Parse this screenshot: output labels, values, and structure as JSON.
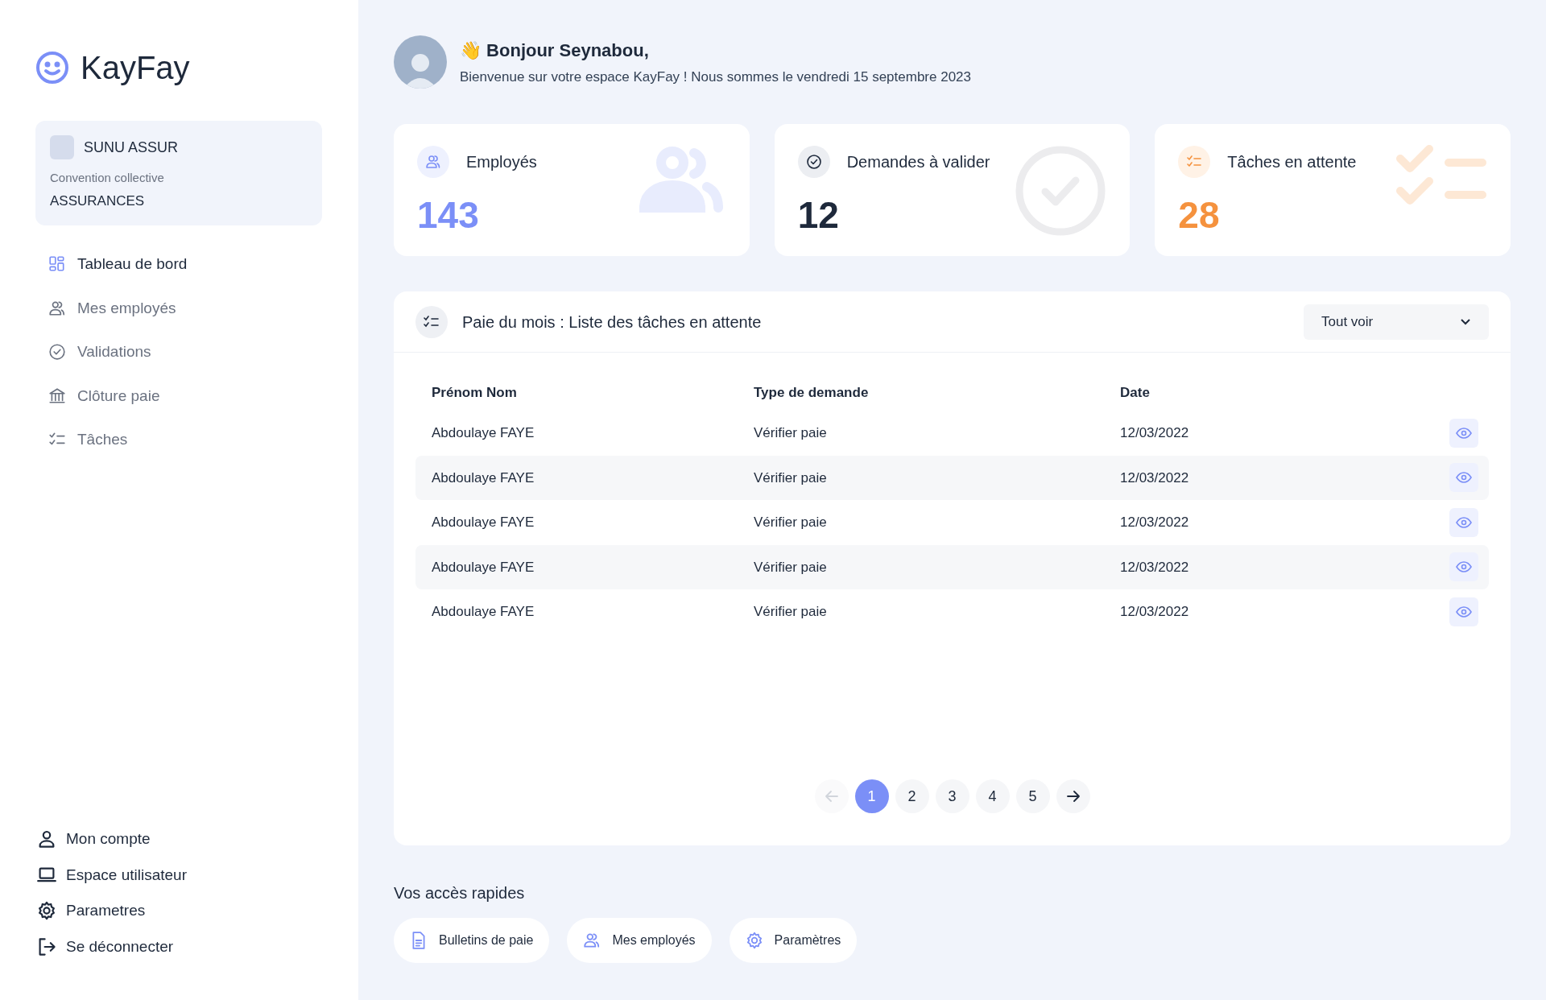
{
  "sidebar": {
    "brand": "KayFay",
    "company": {
      "name": "SUNU ASSUR",
      "label": "Convention collective",
      "value": "ASSURANCES"
    },
    "items": [
      {
        "label": "Tableau de bord",
        "kind": "dashboard",
        "selected": true
      },
      {
        "label": "Mes employés",
        "kind": "users",
        "selected": false
      },
      {
        "label": "Validations",
        "kind": "check",
        "selected": false
      },
      {
        "label": "Clôture paie",
        "kind": "bank",
        "selected": false
      },
      {
        "label": "Tâches",
        "kind": "tasks",
        "selected": false
      }
    ],
    "footer_items": [
      {
        "label": "Mon compte",
        "kind": "user"
      },
      {
        "label": "Espace utilisateur",
        "kind": "laptop"
      },
      {
        "label": "Parametres",
        "kind": "gear"
      },
      {
        "label": "Se déconnecter",
        "kind": "logout"
      }
    ]
  },
  "header": {
    "emoji": "👋",
    "greeting": "Bonjour Seynabou,",
    "subtitle": "Bienvenue sur votre espace KayFay ! Nous sommes le vendredi 15 septembre 2023"
  },
  "cards": [
    {
      "kind": "employees",
      "title": "Employés",
      "value": "143"
    },
    {
      "kind": "requests",
      "title": "Demandes à valider",
      "value": "12"
    },
    {
      "kind": "tasks",
      "title": "Tâches en attente",
      "value": "28"
    }
  ],
  "tasks_panel": {
    "title": "Paie du mois : Liste des tâches en attente",
    "filter": "Tout voir",
    "columns": [
      "Prénom Nom",
      "Type de demande",
      "Date"
    ],
    "rows": [
      {
        "name": "Abdoulaye FAYE",
        "type": "Vérifier paie",
        "date": "12/03/2022"
      },
      {
        "name": "Abdoulaye FAYE",
        "type": "Vérifier paie",
        "date": "12/03/2022"
      },
      {
        "name": "Abdoulaye FAYE",
        "type": "Vérifier paie",
        "date": "12/03/2022"
      },
      {
        "name": "Abdoulaye FAYE",
        "type": "Vérifier paie",
        "date": "12/03/2022"
      },
      {
        "name": "Abdoulaye FAYE",
        "type": "Vérifier paie",
        "date": "12/03/2022"
      }
    ],
    "pagination": {
      "previous_disabled": true,
      "pages": [
        {
          "label": "1",
          "selected": true
        },
        {
          "label": "2",
          "selected": false
        },
        {
          "label": "3",
          "selected": false
        },
        {
          "label": "4",
          "selected": false
        },
        {
          "label": "5",
          "selected": false
        }
      ]
    }
  },
  "quick_access": {
    "title": "Vos accès rapides",
    "items": [
      {
        "label": "Bulletins de paie",
        "kind": "document"
      },
      {
        "label": "Mes employés",
        "kind": "users"
      },
      {
        "label": "Paramètres",
        "kind": "gear"
      }
    ]
  }
}
